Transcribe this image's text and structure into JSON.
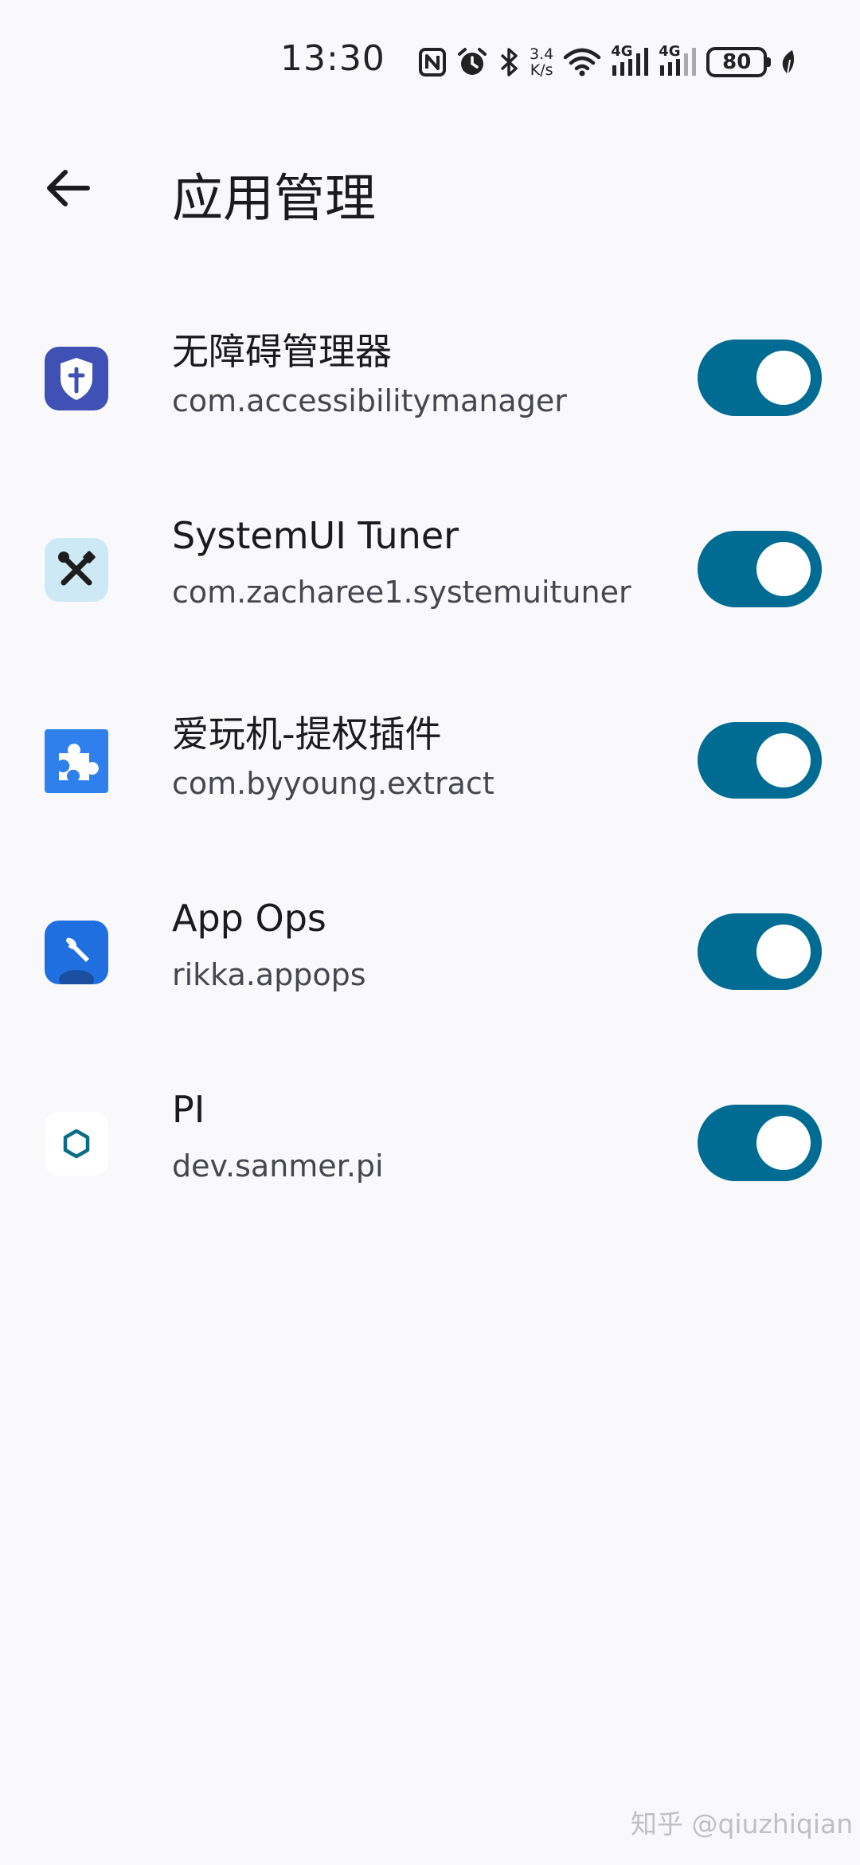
{
  "status_bar": {
    "time": "13:30",
    "net_speed_value": "3.4",
    "net_speed_unit": "K/s",
    "signal_1_label": "4G",
    "signal_2_label": "4G",
    "battery_level": "80",
    "icons": [
      "nfc-icon",
      "alarm-icon",
      "bluetooth-icon",
      "wifi-icon",
      "cell-signal-icon",
      "cell-signal-icon",
      "battery-icon",
      "leaf-icon"
    ]
  },
  "app_bar": {
    "back_icon": "arrow-back-icon",
    "title": "应用管理"
  },
  "apps": [
    {
      "name": "无障碍管理器",
      "package": "com.accessibilitymanager",
      "icon": "shield-cross-icon",
      "enabled": true
    },
    {
      "name": "SystemUI Tuner",
      "package": "com.zacharee1.systemuituner",
      "icon": "tools-icon",
      "enabled": true
    },
    {
      "name": "爱玩机-提权插件",
      "package": "com.byyoung.extract",
      "icon": "puzzle-icon",
      "enabled": true
    },
    {
      "name": "App Ops",
      "package": "rikka.appops",
      "icon": "wrench-icon",
      "enabled": true
    },
    {
      "name": "PI",
      "package": "dev.sanmer.pi",
      "icon": "hexagon-icon",
      "enabled": true
    }
  ],
  "colors": {
    "background": "#f9f9fc",
    "switch_on": "#006b93",
    "thumb": "#ffffff"
  },
  "watermark": "知乎 @qiuzhiqian"
}
